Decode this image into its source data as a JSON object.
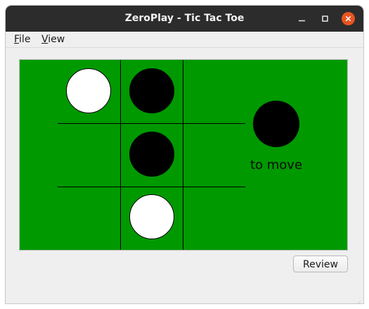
{
  "window": {
    "title": "ZeroPlay - Tic Tac Toe",
    "controls": [
      "minimize-icon",
      "maximize-icon",
      "close-icon"
    ]
  },
  "menu": {
    "file": {
      "mnemonic": "F",
      "rest": "ile"
    },
    "view": {
      "mnemonic": "V",
      "rest": "iew"
    }
  },
  "board": {
    "background": "#009900",
    "cells": [
      [
        "white",
        "black",
        ""
      ],
      [
        "",
        "black",
        ""
      ],
      [
        "",
        "white",
        ""
      ]
    ]
  },
  "turn": {
    "piece": "black",
    "label": "to move"
  },
  "buttons": {
    "review": "Review"
  },
  "colors": {
    "titlebar": "#2c2c2c",
    "close_button": "#e95420",
    "board": "#009900"
  }
}
